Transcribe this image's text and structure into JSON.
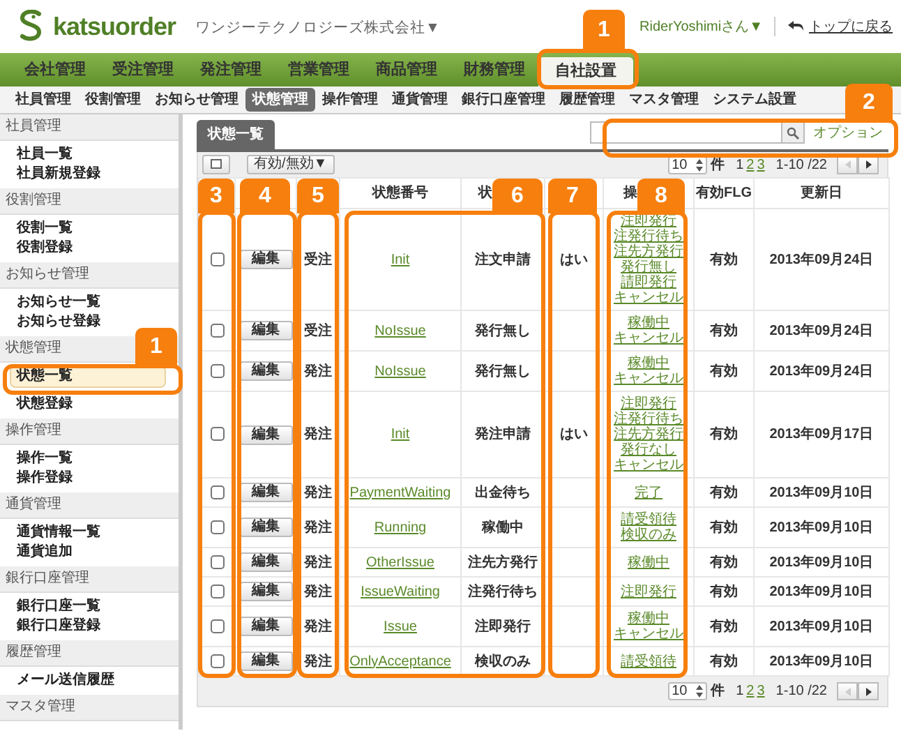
{
  "app": {
    "logo_text": "katsuorder",
    "company": "ワンジーテクノロジーズ株式会社▼",
    "user": "RiderYoshimiさん▼",
    "home_link": "トップに戻る"
  },
  "main_nav": [
    {
      "label": "会社管理",
      "selected": false
    },
    {
      "label": "受注管理",
      "selected": false
    },
    {
      "label": "発注管理",
      "selected": false
    },
    {
      "label": "営業管理",
      "selected": false
    },
    {
      "label": "商品管理",
      "selected": false
    },
    {
      "label": "財務管理",
      "selected": false
    },
    {
      "label": "自社設置",
      "selected": true
    }
  ],
  "sub_nav": [
    {
      "label": "社員管理",
      "selected": false
    },
    {
      "label": "役割管理",
      "selected": false
    },
    {
      "label": "お知らせ管理",
      "selected": false
    },
    {
      "label": "状態管理",
      "selected": true
    },
    {
      "label": "操作管理",
      "selected": false
    },
    {
      "label": "通貨管理",
      "selected": false
    },
    {
      "label": "銀行口座管理",
      "selected": false
    },
    {
      "label": "履歴管理",
      "selected": false
    },
    {
      "label": "マスタ管理",
      "selected": false
    },
    {
      "label": "システム設置",
      "selected": false
    }
  ],
  "sidebar": [
    {
      "title": "社員管理",
      "items": [
        {
          "label": "社員一覧",
          "selected": false
        },
        {
          "label": "社員新規登録",
          "selected": false
        }
      ]
    },
    {
      "title": "役割管理",
      "items": [
        {
          "label": "役割一覧",
          "selected": false
        },
        {
          "label": "役割登録",
          "selected": false
        }
      ]
    },
    {
      "title": "お知らせ管理",
      "items": [
        {
          "label": "お知らせ一覧",
          "selected": false
        },
        {
          "label": "お知らせ登録",
          "selected": false
        }
      ]
    },
    {
      "title": "状態管理",
      "items": [
        {
          "label": "状態一覧",
          "selected": true
        },
        {
          "label": "状態登録",
          "selected": false
        }
      ]
    },
    {
      "title": "操作管理",
      "items": [
        {
          "label": "操作一覧",
          "selected": false
        },
        {
          "label": "操作登録",
          "selected": false
        }
      ]
    },
    {
      "title": "通貨管理",
      "items": [
        {
          "label": "通貨情報一覧",
          "selected": false
        },
        {
          "label": "通貨追加",
          "selected": false
        }
      ]
    },
    {
      "title": "銀行口座管理",
      "items": [
        {
          "label": "銀行口座一覧",
          "selected": false
        },
        {
          "label": "銀行口座登録",
          "selected": false
        }
      ]
    },
    {
      "title": "履歴管理",
      "items": [
        {
          "label": "メール送信履歴",
          "selected": false
        }
      ]
    },
    {
      "title": "マスタ管理"
    }
  ],
  "panel": {
    "tab": "状態一覧",
    "option_link": "オプション",
    "toggle_menu": "有効/無効▼"
  },
  "pagers": [
    {
      "page_size": "10",
      "unit": "件",
      "pages": [
        {
          "label": "1",
          "selected": true
        },
        {
          "label": "2",
          "selected": false
        },
        {
          "label": "3",
          "selected": false
        }
      ],
      "range": "1-10 /22",
      "prev_disabled": true,
      "next_disabled": false
    },
    {
      "page_size": "10",
      "unit": "件",
      "pages": [
        {
          "label": "1",
          "selected": true
        },
        {
          "label": "2",
          "selected": false
        },
        {
          "label": "3",
          "selected": false
        }
      ],
      "range": "1-10 /22",
      "prev_disabled": true,
      "next_disabled": false
    }
  ],
  "columns": [
    {},
    {},
    {},
    {
      "label": "状態番号"
    },
    {
      "label": "状"
    },
    {},
    {
      "label": "操"
    },
    {
      "label": "有効FLG"
    },
    {
      "label": "更新日"
    }
  ],
  "rows": [
    {
      "checked": false,
      "edit": "編集",
      "type": "受注",
      "code": "Init",
      "name": "注文申請",
      "flag": "はい",
      "operations": [
        "注即発行",
        "注発行待ち",
        "注先方発行",
        "発行無し",
        "請即発行",
        "キャンセル"
      ],
      "valid": "有効",
      "updated": "2013年09月24日"
    },
    {
      "checked": false,
      "edit": "編集",
      "type": "受注",
      "code": "NoIssue",
      "name": "発行無し",
      "operations": [
        "稼働中",
        "キャンセル"
      ],
      "valid": "有効",
      "updated": "2013年09月24日"
    },
    {
      "checked": false,
      "edit": "編集",
      "type": "発注",
      "code": "NoIssue",
      "name": "発行無し",
      "operations": [
        "稼働中",
        "キャンセル"
      ],
      "valid": "有効",
      "updated": "2013年09月24日"
    },
    {
      "checked": false,
      "edit": "編集",
      "type": "発注",
      "code": "Init",
      "name": "発注申請",
      "flag": "はい",
      "operations": [
        "注即発行",
        "注発行待ち",
        "注先方発行",
        "発行なし",
        "キャンセル"
      ],
      "valid": "有効",
      "updated": "2013年09月17日"
    },
    {
      "checked": false,
      "edit": "編集",
      "type": "発注",
      "code": "PaymentWaiting",
      "name": "出金待ち",
      "operations": [
        "完了"
      ],
      "valid": "有効",
      "updated": "2013年09月10日"
    },
    {
      "checked": false,
      "edit": "編集",
      "type": "発注",
      "code": "Running",
      "name": "稼働中",
      "operations": [
        "請受領待",
        "検収のみ"
      ],
      "valid": "有効",
      "updated": "2013年09月10日"
    },
    {
      "checked": false,
      "edit": "編集",
      "type": "発注",
      "code": "OtherIssue",
      "name": "注先方発行",
      "operations": [
        "稼働中"
      ],
      "valid": "有効",
      "updated": "2013年09月10日"
    },
    {
      "checked": false,
      "edit": "編集",
      "type": "発注",
      "code": "IssueWaiting",
      "name": "注発行待ち",
      "operations": [
        "注即発行"
      ],
      "valid": "有効",
      "updated": "2013年09月10日"
    },
    {
      "checked": false,
      "edit": "編集",
      "type": "発注",
      "code": "Issue",
      "name": "注即発行",
      "operations": [
        "稼働中",
        "キャンセル"
      ],
      "valid": "有効",
      "updated": "2013年09月10日"
    },
    {
      "checked": false,
      "edit": "編集",
      "type": "発注",
      "code": "OnlyAcceptance",
      "name": "検収のみ",
      "operations": [
        "請受領待"
      ],
      "valid": "有効",
      "updated": "2013年09月10日"
    }
  ],
  "callouts": [
    {
      "number": "1"
    },
    {
      "number": "2"
    },
    {
      "number": "1"
    },
    {
      "number": "3"
    },
    {
      "number": "4"
    },
    {
      "number": "5"
    },
    {
      "number": "6"
    },
    {
      "number": "7"
    },
    {
      "number": "8"
    }
  ]
}
